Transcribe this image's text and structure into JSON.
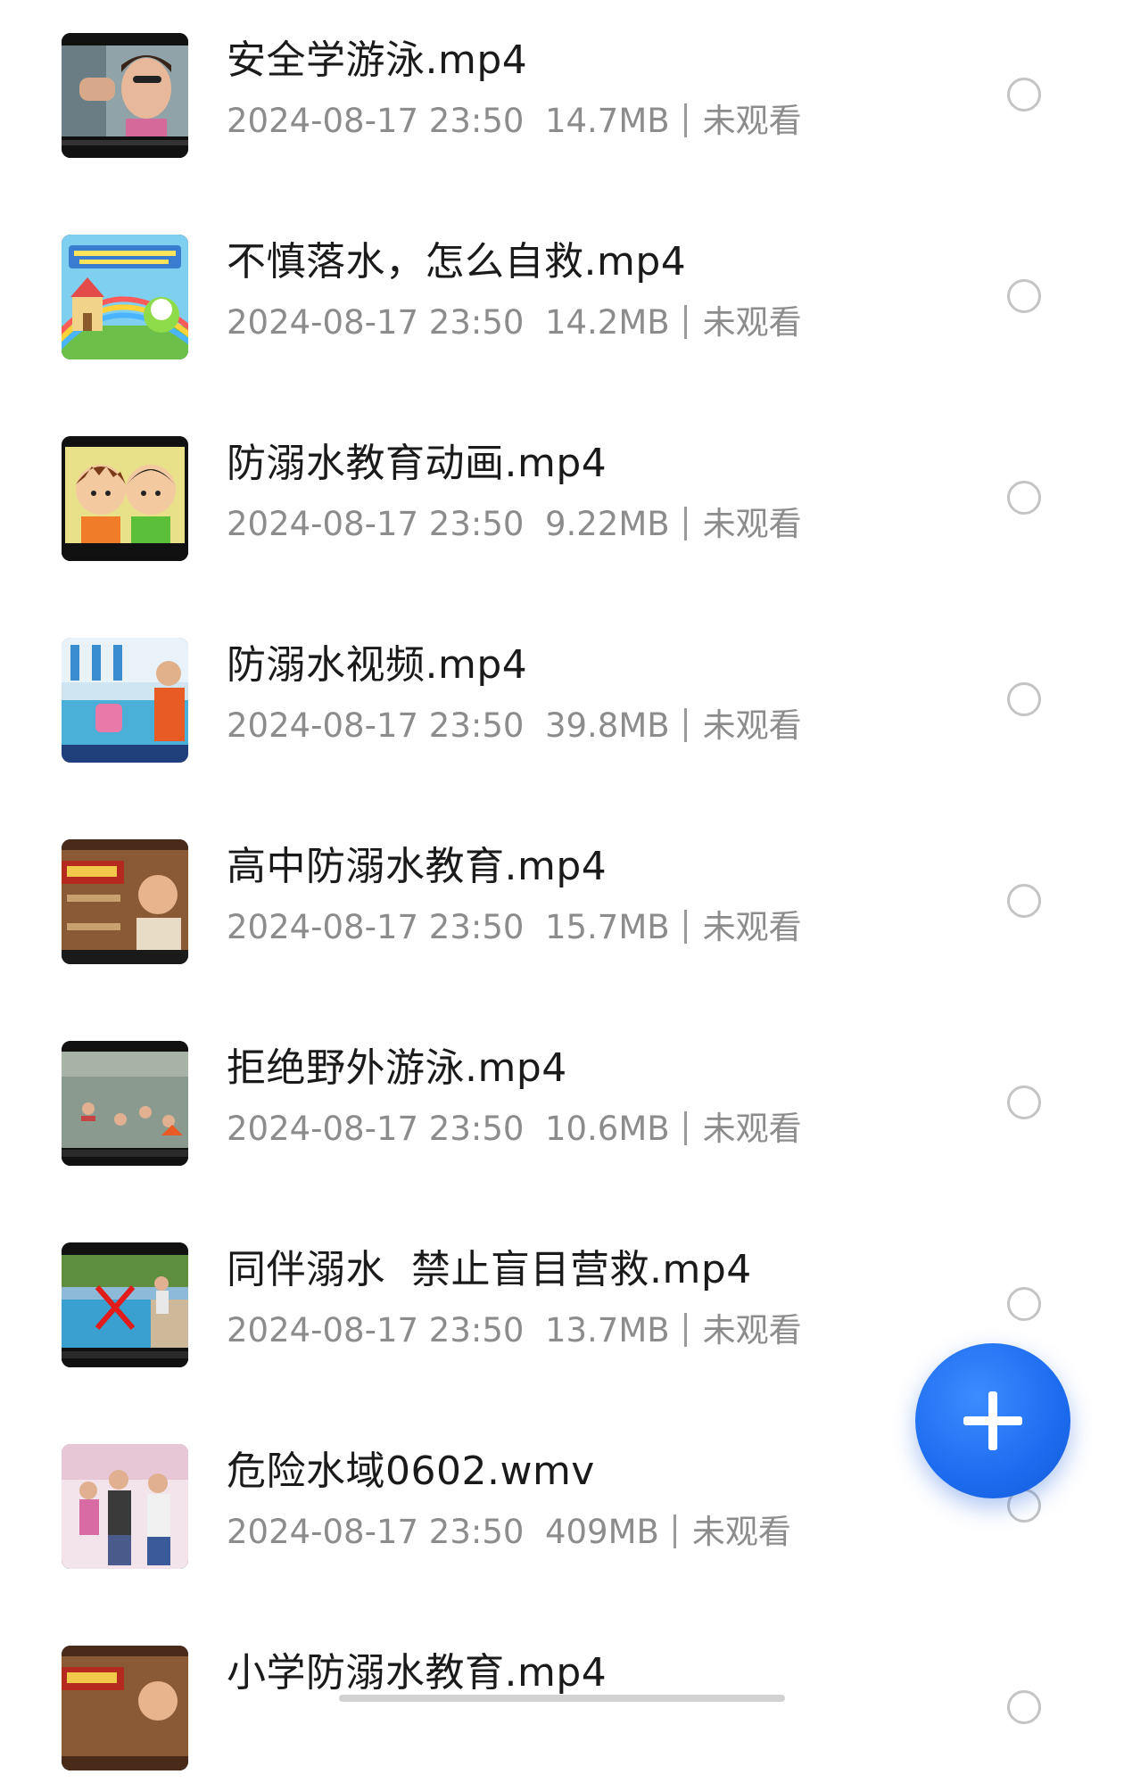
{
  "videos": [
    {
      "title": "安全学游泳.mp4",
      "datetime": "2024-08-17 23:50",
      "size": "14.7MB",
      "status": "未观看",
      "thumb_icon": "girl-swimming-goggles-thumbnail"
    },
    {
      "title": "不慎落水，怎么自救.mp4",
      "datetime": "2024-08-17 23:50",
      "size": "14.2MB",
      "status": "未观看",
      "thumb_icon": "cartoon-castle-rainbow-thumbnail"
    },
    {
      "title": "防溺水教育动画.mp4",
      "datetime": "2024-08-17 23:50",
      "size": "9.22MB",
      "status": "未观看",
      "thumb_icon": "cartoon-boys-thumbnail"
    },
    {
      "title": "防溺水视频.mp4",
      "datetime": "2024-08-17 23:50",
      "size": "39.8MB",
      "status": "未观看",
      "thumb_icon": "swimming-pool-thumbnail"
    },
    {
      "title": "高中防溺水教育.mp4",
      "datetime": "2024-08-17 23:50",
      "size": "15.7MB",
      "status": "未观看",
      "thumb_icon": "lecturer-bookshelf-thumbnail"
    },
    {
      "title": "拒绝野外游泳.mp4",
      "datetime": "2024-08-17 23:50",
      "size": "10.6MB",
      "status": "未观看",
      "thumb_icon": "swimmers-in-river-thumbnail"
    },
    {
      "title": "同伴溺水  禁止盲目营救.mp4",
      "datetime": "2024-08-17 23:50",
      "size": "13.7MB",
      "status": "未观看",
      "thumb_icon": "pool-red-x-thumbnail"
    },
    {
      "title": "危险水域0602.wmv",
      "datetime": "2024-08-17 23:50",
      "size": "409MB",
      "status": "未观看",
      "thumb_icon": "family-crowd-thumbnail"
    },
    {
      "title": "小学防溺水教育.mp4",
      "datetime": "",
      "size": "",
      "status": "",
      "thumb_icon": "lecturer-bookshelf-thumbnail"
    }
  ],
  "fab": {
    "icon": "plus-icon"
  },
  "colors": {
    "accent": "#1d6cf0",
    "title": "#1a1a1a",
    "meta": "#8c8c8c"
  }
}
